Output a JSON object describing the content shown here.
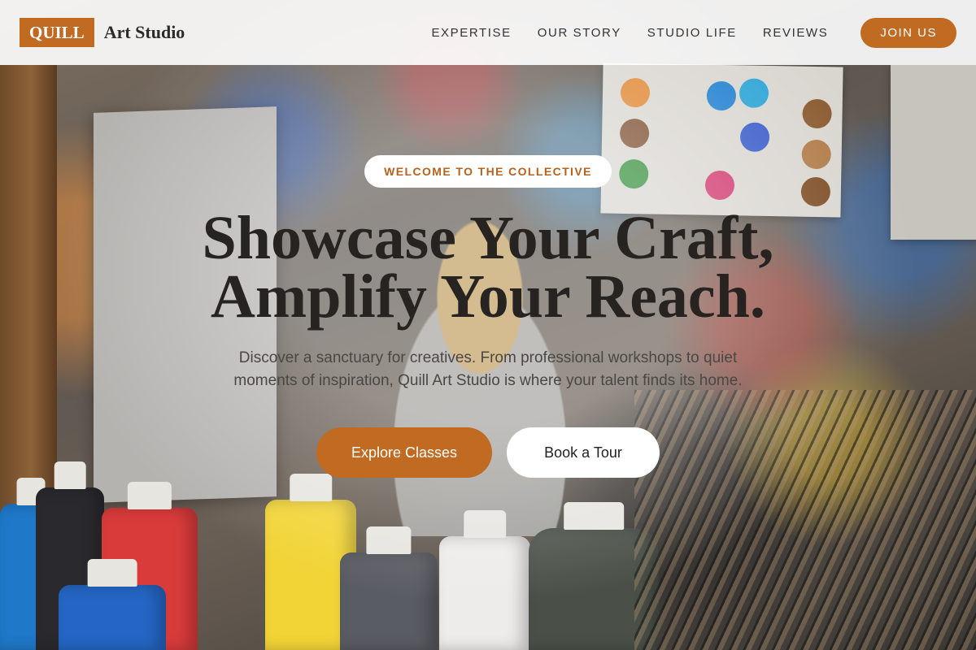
{
  "brand": {
    "logo": "QUILL",
    "name": "Art Studio",
    "accent_color": "#c06a22"
  },
  "nav": {
    "links": [
      "EXPERTISE",
      "OUR STORY",
      "STUDIO LIFE",
      "REVIEWS"
    ],
    "cta_label": "JOIN US"
  },
  "hero": {
    "badge": "WELCOME TO THE COLLECTIVE",
    "headline_line1": "Showcase Your Craft,",
    "headline_line2": "Amplify Your Reach.",
    "subtext": "Discover a sanctuary for creatives. From professional workshops to quiet moments of inspiration, Quill Art Studio is where your talent finds its home.",
    "primary_cta": "Explore Classes",
    "secondary_cta": "Book a Tour"
  },
  "background": {
    "image": "art-studio-paint-bottles-photo"
  }
}
